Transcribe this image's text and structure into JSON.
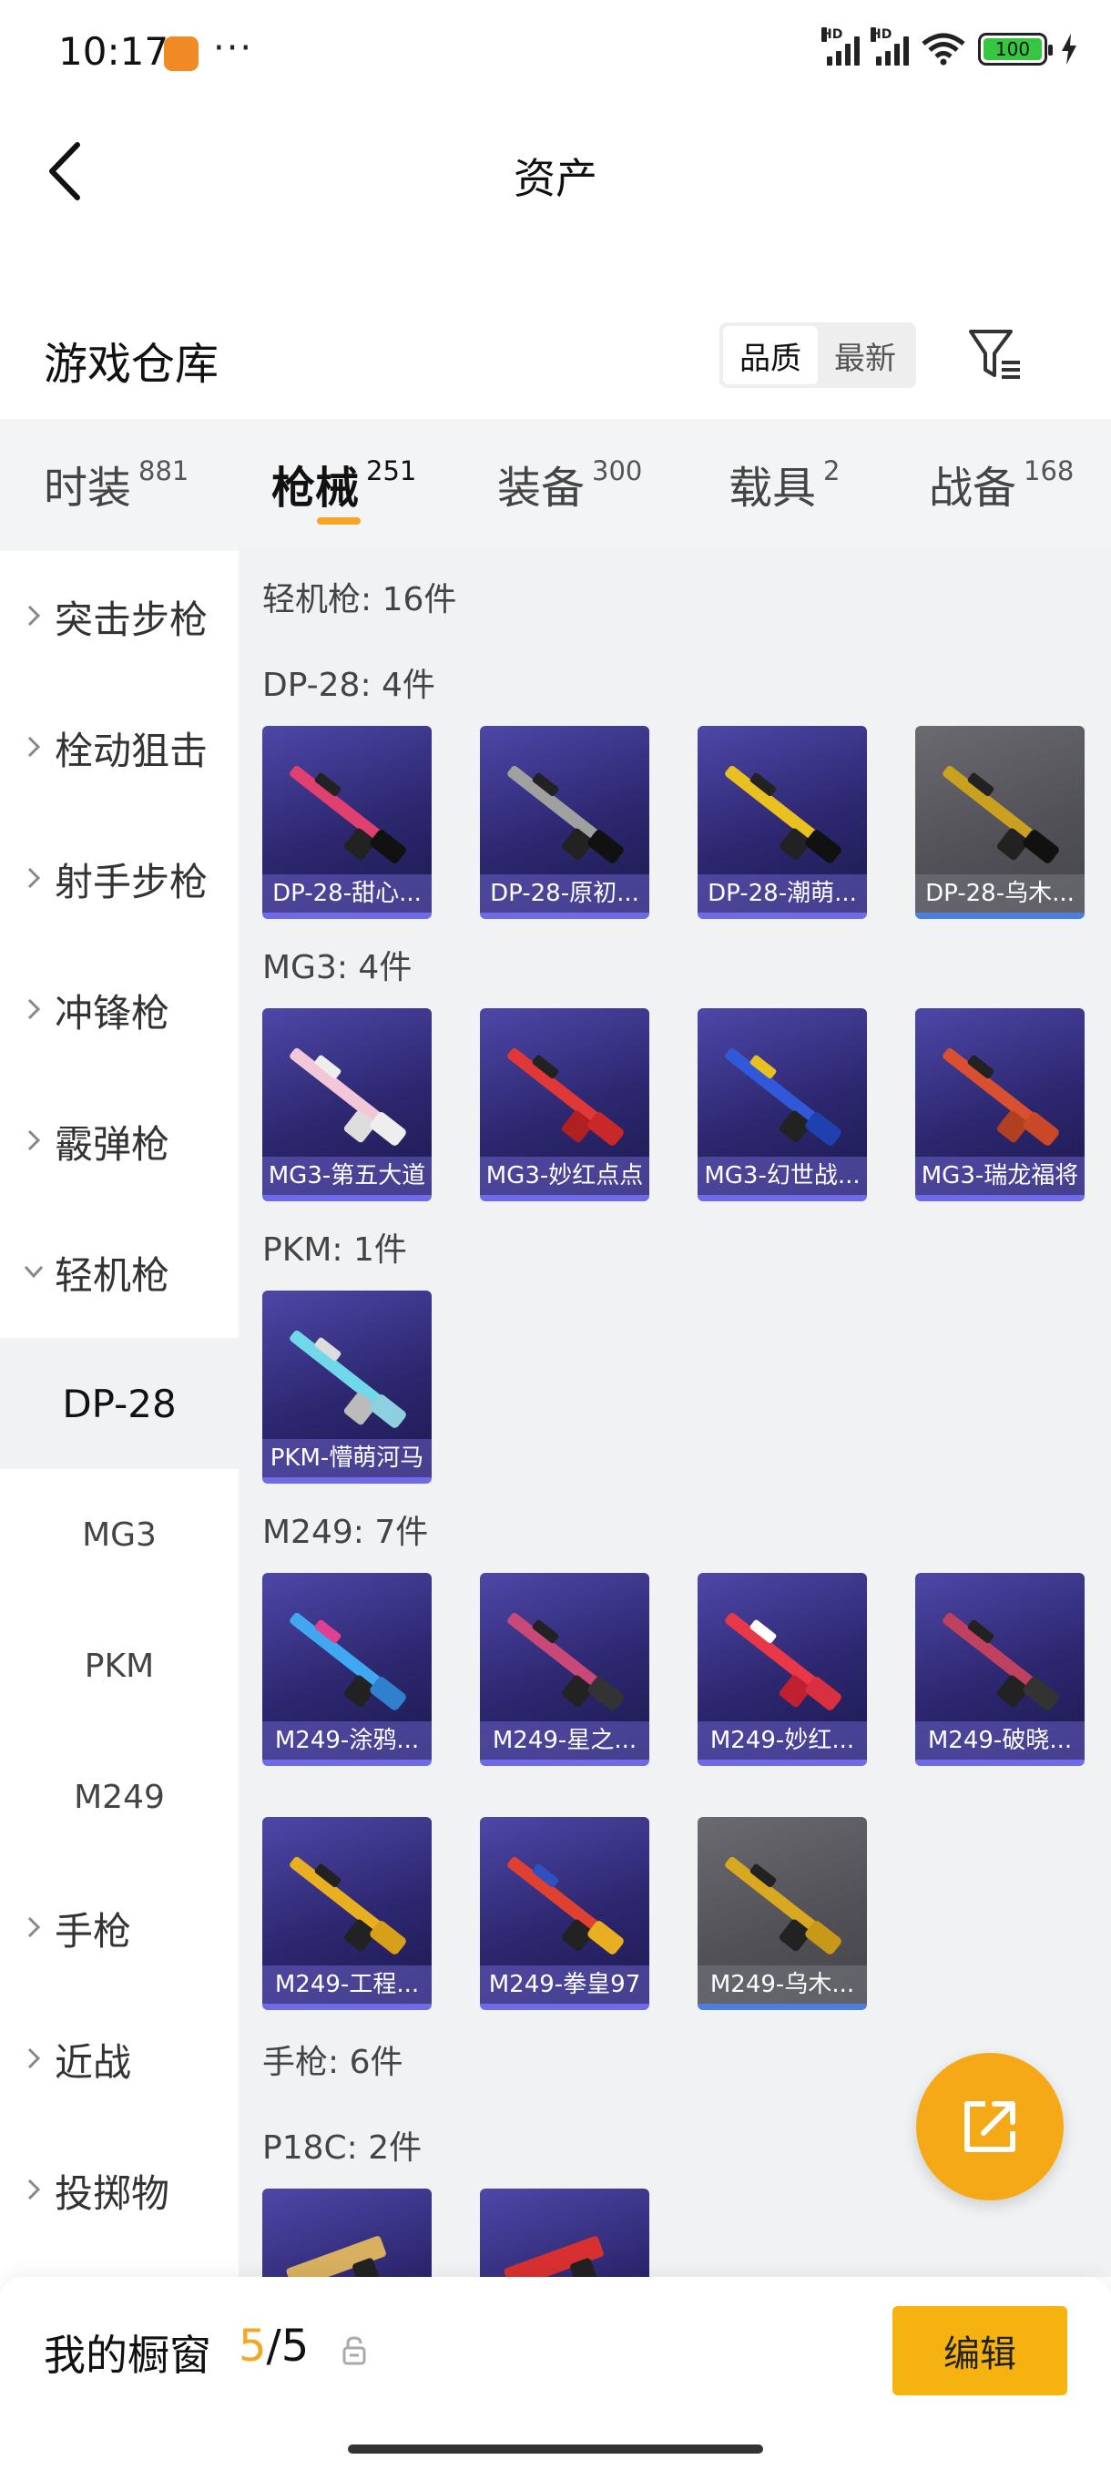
{
  "status_bar": {
    "time": "10:17",
    "more": "···",
    "battery": "100",
    "hd_badge": "HD"
  },
  "header": {
    "title": "资产",
    "back_icon": "chevron-left-icon"
  },
  "warehouse": {
    "title": "游戏仓库",
    "sort_options": [
      "品质",
      "最新"
    ],
    "sort_selected": "品质",
    "filter_icon": "filter-icon"
  },
  "tabs": [
    {
      "label": "时装",
      "count": "881"
    },
    {
      "label": "枪械",
      "count": "251"
    },
    {
      "label": "装备",
      "count": "300"
    },
    {
      "label": "载具",
      "count": "2"
    },
    {
      "label": "战备",
      "count": "168"
    }
  ],
  "active_tab": "枪械",
  "sidebar": {
    "categories": [
      "突击步枪",
      "栓动狙击",
      "射手步枪",
      "冲锋枪",
      "霰弹枪",
      "轻机枪",
      "手枪",
      "近战",
      "投掷物"
    ],
    "expanded": "轻机枪",
    "subcategories": [
      "DP-28",
      "MG3",
      "PKM",
      "M249"
    ],
    "selected_sub": "DP-28"
  },
  "content": {
    "section_lmg": "轻机枪: 16件",
    "groups": [
      {
        "header": "DP-28: 4件",
        "items": [
          {
            "name": "DP-28-甜心...",
            "accent": "#e04070"
          },
          {
            "name": "DP-28-原初...",
            "accent": "#a0a0a0"
          },
          {
            "name": "DP-28-潮萌...",
            "accent": "#e8c020"
          },
          {
            "name": "DP-28-乌木...",
            "accent": "#caa020"
          }
        ]
      },
      {
        "header": "MG3: 4件",
        "items": [
          {
            "name": "MG3-第五大道",
            "accent": "#f2c8d8"
          },
          {
            "name": "MG3-妙红点点",
            "accent": "#e03838"
          },
          {
            "name": "MG3-幻世战...",
            "accent": "#3058d8"
          },
          {
            "name": "MG3-瑞龙福将",
            "accent": "#d85030"
          }
        ]
      },
      {
        "header": "PKM: 1件",
        "items": [
          {
            "name": "PKM-懵萌河马",
            "accent": "#70d8e8"
          }
        ]
      },
      {
        "header": "M249: 7件",
        "items": [
          {
            "name": "M249-涂鸦...",
            "accent": "#40a8f0"
          },
          {
            "name": "M249-星之...",
            "accent": "#c84878"
          },
          {
            "name": "M249-妙红...",
            "accent": "#e83848"
          },
          {
            "name": "M249-破晓...",
            "accent": "#c04060"
          },
          {
            "name": "M249-工程...",
            "accent": "#e8b020"
          },
          {
            "name": "M249-拳皇97",
            "accent": "#e04030"
          },
          {
            "name": "M249-乌木...",
            "accent": "#d8a820"
          }
        ]
      }
    ],
    "section_pistol": "手枪: 6件",
    "p18c_header": "P18C: 2件"
  },
  "bottom_bar": {
    "label": "我的橱窗",
    "current": "5",
    "separator": "/",
    "total": "5",
    "edit_label": "编辑"
  },
  "colors": {
    "accent": "#f5a623",
    "item_bg": "#2d2770",
    "item_bar": "#6e6ae8"
  }
}
